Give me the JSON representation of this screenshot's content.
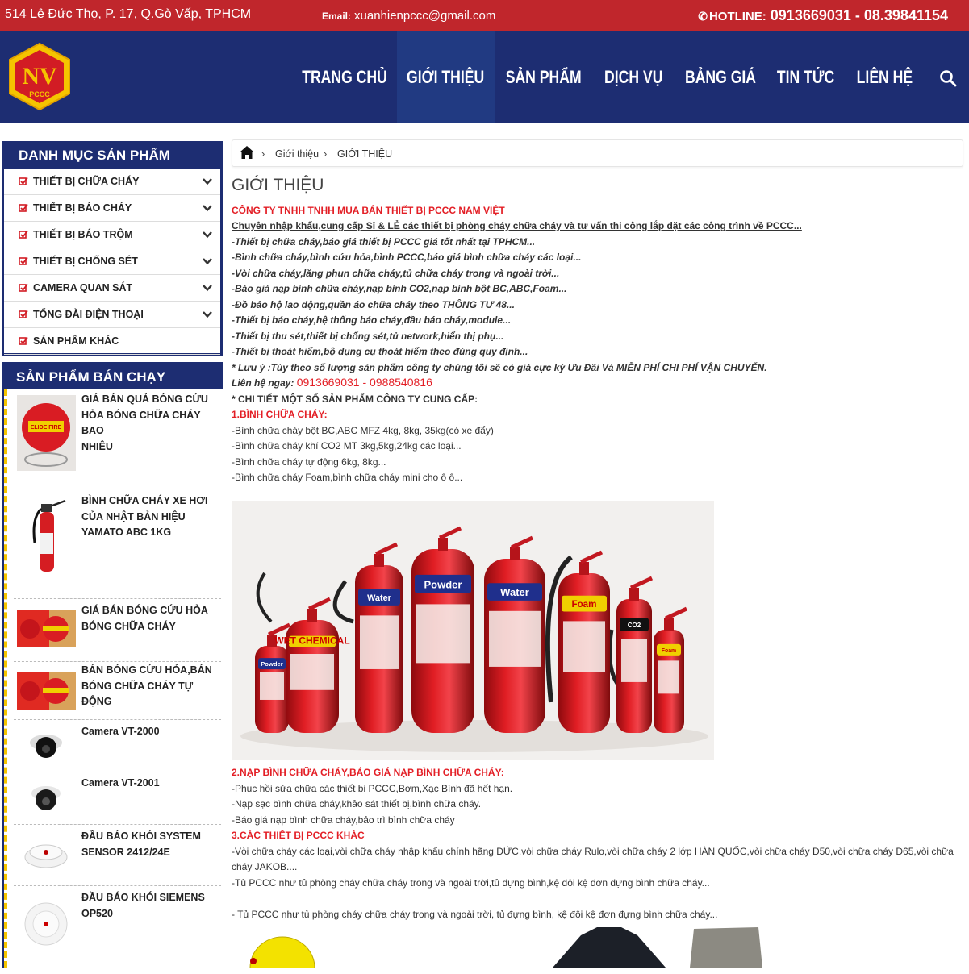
{
  "topbar": {
    "address": "514 Lê Đức Thọ, P. 17, Q.Gò Vấp, TPHCM",
    "email_label": "Email:",
    "email": "xuanhienpccc@gmail.com",
    "hotline_label": "HOTLINE:",
    "hotline_numbers": "0913669031 - 08.39841154",
    "accent_color": "#c0262c"
  },
  "header": {
    "bg_color": "#1d2d72",
    "logo_text": "NV",
    "logo_sub": "PCCC",
    "nav": [
      "TRANG CHỦ",
      "GIỚI THIỆU",
      "SẢN PHẨM",
      "DỊCH VỤ",
      "BẢNG GIÁ",
      "TIN TỨC",
      "LIÊN HỆ"
    ],
    "active_nav": "GIỚI THIỆU"
  },
  "sidebar": {
    "categories_title": "DANH MỤC SẢN PHẨM",
    "categories": [
      {
        "label": "THIẾT BỊ CHỮA CHÁY",
        "has_children": true
      },
      {
        "label": "THIẾT BỊ BÁO CHÁY",
        "has_children": true
      },
      {
        "label": "THIẾT BỊ BÁO TRỘM",
        "has_children": true
      },
      {
        "label": "THIẾT BỊ CHỐNG SÉT",
        "has_children": true
      },
      {
        "label": "CAMERA QUAN SÁT",
        "has_children": true
      },
      {
        "label": "TỔNG ĐÀI ĐIỆN THOẠI",
        "has_children": true
      },
      {
        "label": "SẢN PHẨM KHÁC",
        "has_children": false
      }
    ],
    "bestseller_title": "SẢN PHẨM BÁN CHẠY",
    "bestsellers": [
      {
        "lines": [
          "GIÁ BÁN QUẢ BÓNG CỨU",
          "HỎA BÓNG CHỮA CHÁY BAO",
          "NHIÊU"
        ]
      },
      {
        "lines": [
          "BÌNH CHỮA CHÁY XE HƠI",
          "CỦA NHẬT BẢN HIỆU",
          "YAMATO ABC 1KG"
        ]
      },
      {
        "lines": [
          "GIÁ BÁN BÓNG CỨU HỎA",
          "BÓNG CHỮA CHÁY"
        ]
      },
      {
        "lines": [
          "BÁN BÓNG CỨU HỎA,BÁN",
          "BÓNG CHỮA CHÁY TỰ ĐỘNG"
        ]
      },
      {
        "lines": [
          "Camera VT-2000"
        ]
      },
      {
        "lines": [
          "Camera VT-2001"
        ]
      },
      {
        "lines": [
          "ĐẦU BÁO KHÓI SYSTEM",
          "SENSOR 2412/24E"
        ]
      },
      {
        "lines": [
          "ĐẦU BÁO KHÓI SIEMENS",
          "OP520"
        ]
      }
    ]
  },
  "breadcrumb": [
    "Giới thiệu",
    "GIỚI THIỆU"
  ],
  "page_title": "GIỚI THIỆU",
  "content": {
    "company": "CÔNG TY TNHH TNHH MUA BÁN THIẾT BỊ PCCC NAM VIỆT",
    "tagline": "Chuyên nhập khẩu,cung cấp Sỉ & LẺ các thiết bị phòng cháy chữa cháy và tư vấn thi công lắp đặt các công trình về PCCC...",
    "bullets": [
      "-Thiết bị chữa cháy,báo giá thiết bị PCCC giá tốt nhất tại TPHCM...",
      "-Bình chữa cháy,bình cứu hỏa,bình PCCC,báo giá bình chữa cháy các loại...",
      "-Vòi chữa cháy,lăng phun chữa cháy,tủ chữa cháy trong và ngoài trời...",
      "-Báo giá nạp bình chữa cháy,nạp bình CO2,nạp bình bột BC,ABC,Foam...",
      "-Đồ bảo hộ lao động,quần áo chữa cháy theo THÔNG TƯ 48...",
      "-Thiết bị báo cháy,hệ thống báo cháy,đầu báo cháy,module...",
      "-Thiết bị thu sét,thiết bị chống sét,tủ network,hiển thị phụ...",
      "-Thiết bị thoát hiểm,bộ dụng cụ thoát hiểm theo đúng quy định..."
    ],
    "note": "* Lưu ý :Tùy theo số lượng sản phẩm công ty chúng tôi sẽ có giá cực kỳ Ưu Đãi Và MIỄN PHÍ CHI PHÍ VẬN CHUYỂN.",
    "contact_label": "Liên hệ ngay: ",
    "contact_phones": "0913669031 - 0988540816",
    "detail_heading": "* CHI TIẾT MỘT SỐ SẢN PHẨM CÔNG TY CUNG CẤP:",
    "section1_title": "1.BÌNH CHỮA CHÁY:",
    "section1_items": [
      "-Bình chữa cháy bột BC,ABC MFZ 4kg, 8kg, 35kg(có xe đẩy)",
      "-Bình chữa cháy khí CO2 MT 3kg,5kg,24kg các loại...",
      "-Bình chữa cháy tự động 6kg, 8kg...",
      "-Bình chữa cháy Foam,bình chữa cháy mini cho ô ô..."
    ],
    "section2_title": "2.NẠP BÌNH CHỮA CHÁY,BÁO GIÁ NẠP BÌNH CHỮA CHÁY:",
    "section2_items": [
      "-Phục hồi sửa chữa các thiết bị PCCC,Bơm,Xạc Bình đã hết hạn.",
      "-Nạp sạc bình chữa cháy,khảo sát thiết bị,bình chữa cháy.",
      "-Báo giá nạp bình chữa cháy,bảo trì bình chữa cháy"
    ],
    "section3_title": "3.CÁC THIẾT BỊ PCCC KHÁC",
    "section3_line1a": "-Vòi chữa cháy các loại,vòi chữa cháy nhập khẩu chính hãng ĐỨC,vòi chữa cháy Rulo,vòi chữa cháy 2 lớp HÀN QUỐC,vòi chữa cháy D50,vòi chữa cháy D65,vòi chữa",
    "section3_line1b": "cháy JAKOB....",
    "section3_line2": "-Tủ PCCC như tủ phòng cháy chữa cháy trong và ngoài trời,tủ đựng bình,kệ đôi kệ đơn đựng bình chữa cháy...",
    "section3_line3": "- Tủ PCCC như tủ phòng cháy chữa cháy trong và ngoài trời, tủ đựng bình, kệ đôi kệ đơn đựng bình chữa cháy...",
    "extinguisher_labels": [
      "Powder",
      "WET CHEMICAL",
      "Water",
      "Powder",
      "Water",
      "Foam",
      "CO2",
      "Foam"
    ]
  }
}
